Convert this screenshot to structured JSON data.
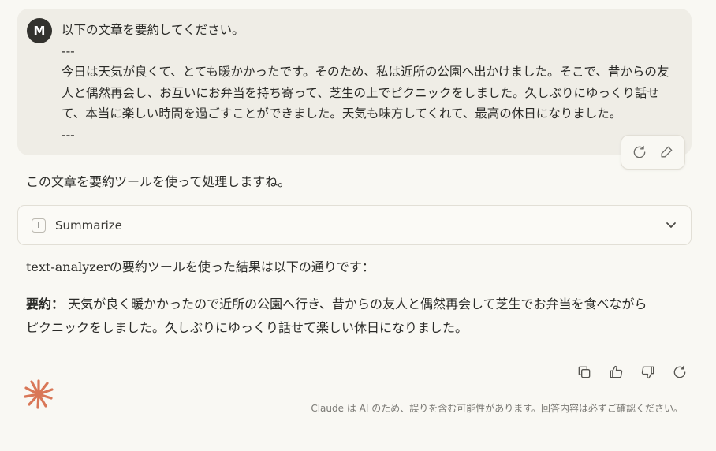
{
  "user_message": {
    "avatar_initial": "M",
    "lines": [
      "以下の文章を要約してください。",
      "---",
      "今日は天気が良くて、とても暖かかったです。そのため、私は近所の公園へ出かけました。そこで、昔からの友人と偶然再会し、お互いにお弁当を持ち寄って、芝生の上でピクニックをしました。久しぶりにゆっくり話せて、本当に楽しい時間を過ごすことができました。天気も味方してくれて、最高の休日になりました。",
      "---"
    ],
    "actions": {
      "retry_icon": "retry-icon",
      "edit_icon": "pencil-icon"
    }
  },
  "assistant": {
    "intro": "この文章を要約ツールを使って処理しますね。",
    "tool": {
      "badge": "T",
      "name": "Summarize",
      "chevron_icon": "chevron-down-icon"
    },
    "result_line": "text-analyzerの要約ツールを使った結果は以下の通りです：",
    "summary_label": "要約：",
    "summary_text": " 天気が良く暖かかったので近所の公園へ行き、昔からの友人と偶然再会して芝生でお弁当を食べながらピクニックをしました。久しぶりにゆっくり話せて楽しい休日になりました。"
  },
  "footer": {
    "action_icons": [
      "copy-icon",
      "thumbs-up-icon",
      "thumbs-down-icon",
      "retry-icon"
    ],
    "disclaimer": "Claude は AI のため、誤りを含む可能性があります。回答内容は必ずご確認ください。"
  },
  "colors": {
    "page_bg": "#f9f8f3",
    "bubble_bg": "#efede6",
    "avatar_bg": "#33322e",
    "claude_accent": "#d97757"
  }
}
